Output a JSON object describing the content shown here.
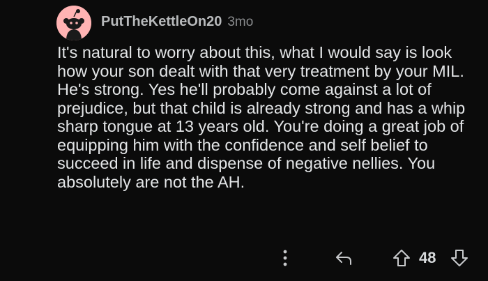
{
  "comment": {
    "username": "PutTheKettleOn20",
    "timestamp": "3mo",
    "body": "It's natural to worry about this, what I would say is look how your son dealt with that very treatment by your MIL. He's strong. Yes he'll probably come against a lot of prejudice, but that child is already strong and has a whip sharp tongue at 13 years old. You're doing a great job of equipping him with the confidence and self belief to succeed in life and dispense of negative nellies. You absolutely are not the AH.",
    "score": "48",
    "avatar": {
      "icon": "snoo-avatar-icon",
      "background": "#ffb3b3"
    }
  },
  "actions": {
    "more_icon": "more-vertical-icon",
    "reply_icon": "reply-arrow-icon",
    "upvote_icon": "upvote-arrow-icon",
    "downvote_icon": "downvote-arrow-icon"
  },
  "colors": {
    "background": "#0b0b0b",
    "text": "#e3e5e7",
    "muted": "#8a8c8e"
  }
}
